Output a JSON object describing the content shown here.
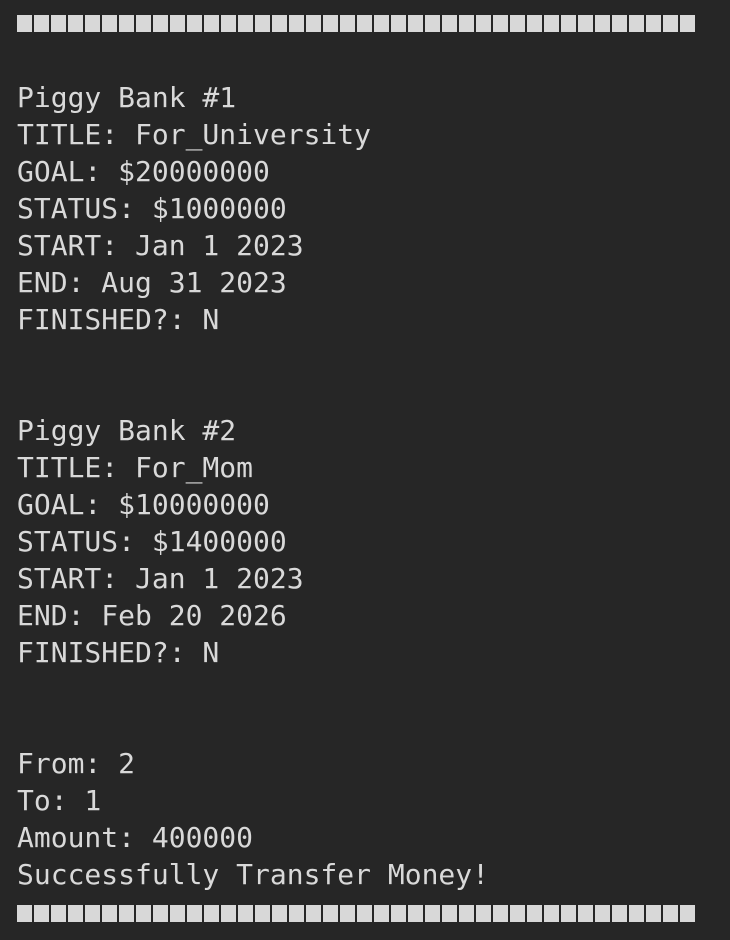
{
  "terminal": {
    "border_char": "■",
    "border_count": 40,
    "banks": [
      {
        "header": "Piggy Bank #1",
        "title": "TITLE: For_University",
        "goal": "GOAL: $20000000",
        "status": "STATUS: $1000000",
        "start": "START: Jan 1 2023",
        "end": "END: Aug 31 2023",
        "finished": "FINISHED?: N"
      },
      {
        "header": "Piggy Bank #2",
        "title": "TITLE: For_Mom",
        "goal": "GOAL: $10000000",
        "status": "STATUS: $1400000",
        "start": "START: Jan 1 2023",
        "end": "END: Feb 20 2026",
        "finished": "FINISHED?: N"
      }
    ],
    "transfer": {
      "from": "From: 2",
      "to": "To: 1",
      "amount": "Amount: 400000",
      "result": "Successfully Transfer Money!"
    }
  }
}
